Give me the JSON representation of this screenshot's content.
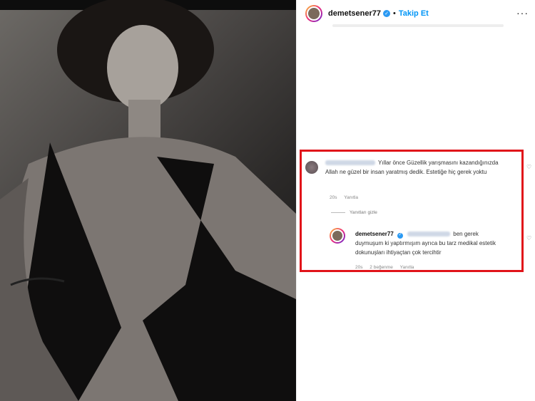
{
  "header": {
    "username": "demetsener77",
    "verified_icon": "✓",
    "separator": "•",
    "follow_label": "Takip Et",
    "more_icon": "···"
  },
  "comment1": {
    "text": "Yıllar önce Güzellik yarışmasını kazandığınızda Allah ne güzel bir insan yaratmış dedik. Estetiğe hiç gerek yoktu",
    "time": "20s",
    "reply_label": "Yanıtla"
  },
  "hide_replies": "Yanıtları gizle",
  "reply": {
    "username": "demetsener77",
    "text": "ben gerek duymuşum ki yaptırmışım ayrıca bu tarz medikal estetik dokunuşları ihtiyaçtan çok tercihtir",
    "time": "20s",
    "likes": "2 beğenme",
    "reply_label": "Yanıtla"
  },
  "colors": {
    "accent": "#0095f6",
    "highlight": "#e1141a",
    "verified": "#2b9af3"
  }
}
